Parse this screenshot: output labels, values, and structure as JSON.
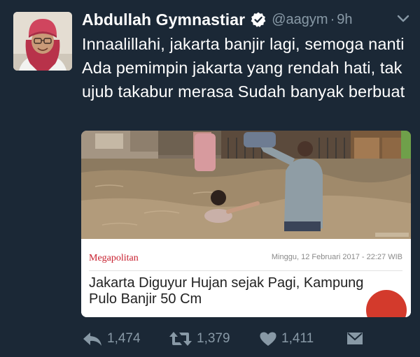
{
  "tweet": {
    "author": {
      "name": "Abdullah Gymnastiar",
      "handle": "@aagym",
      "separator": "·",
      "time": "9h",
      "verified_icon": "verified-badge-icon"
    },
    "text": "Innaalillahi, jakarta banjir lagi, semoga nanti Ada pemimpin jakarta yang rendah hati, tak ujub takabur merasa Sudah banyak berbuat",
    "card": {
      "category": "Megapolitan",
      "date": "Minggu, 12 Februari 2017 - 22:27 WIB",
      "title": "Jakarta Diguyur Hujan sejak Pagi, Kampung Pulo Banjir 50 Cm"
    },
    "actions": {
      "reply_count": "1,474",
      "retweet_count": "1,379",
      "like_count": "1,411"
    },
    "icons": {
      "reply": "reply-icon",
      "retweet": "retweet-icon",
      "like": "heart-icon",
      "message": "direct-message-icon",
      "menu": "chevron-down-icon"
    }
  },
  "colors": {
    "background": "#1b2836",
    "text": "#ffffff",
    "muted": "#8899a6",
    "category": "#c8202f",
    "verified": "#ffffff"
  }
}
